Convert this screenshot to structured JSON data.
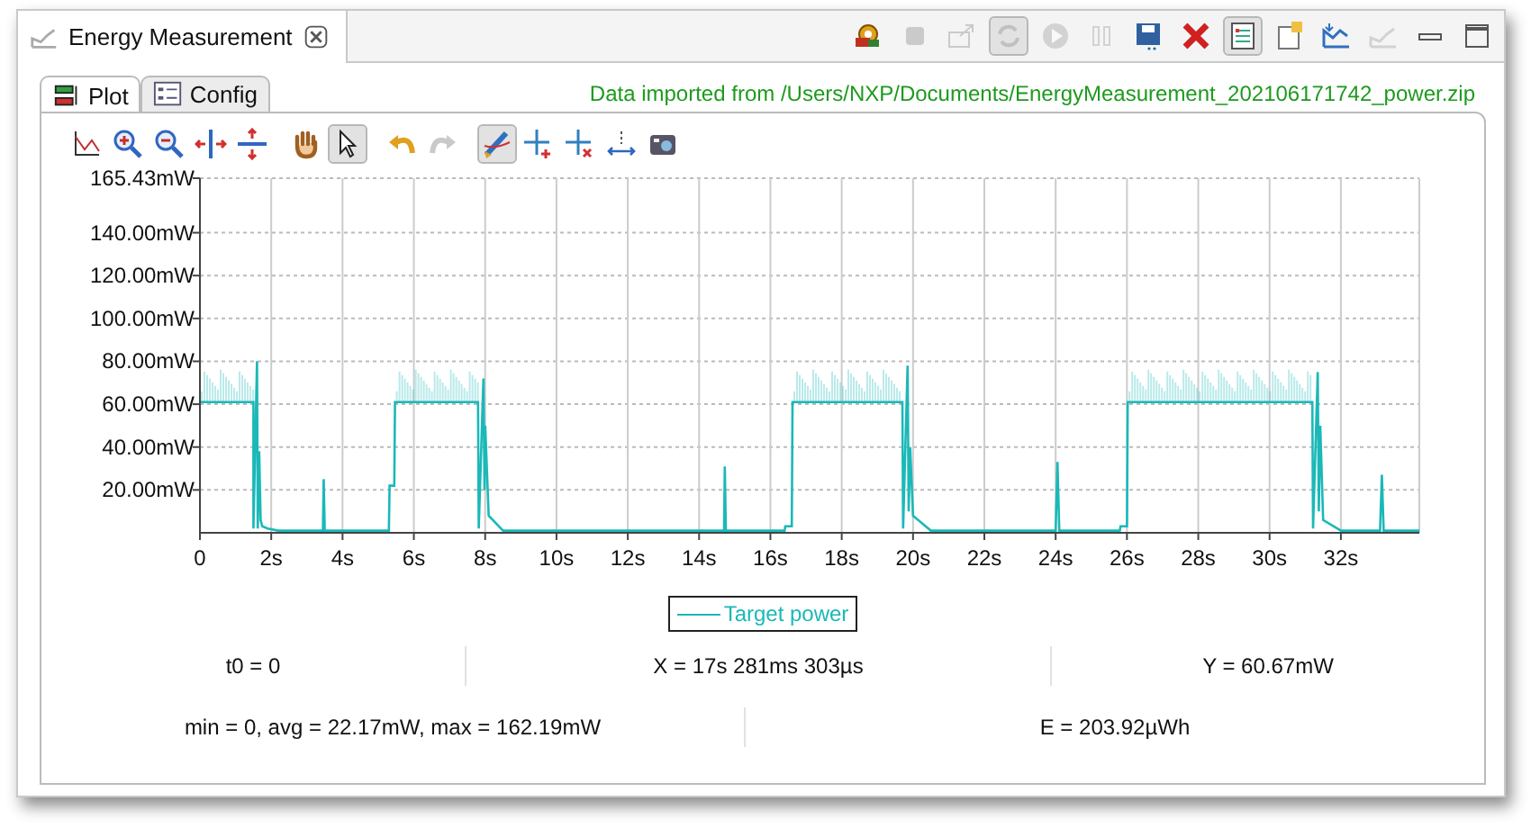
{
  "view_tab": {
    "title": "Energy Measurement",
    "selected": true
  },
  "view_toolbar": [
    {
      "kind": "gear-person",
      "disabled": false,
      "selected": false
    },
    {
      "kind": "stop",
      "disabled": true,
      "selected": false
    },
    {
      "kind": "export",
      "disabled": true,
      "selected": false
    },
    {
      "kind": "sync",
      "disabled": true,
      "selected": true
    },
    {
      "kind": "play",
      "disabled": true,
      "selected": false
    },
    {
      "kind": "pause",
      "disabled": true,
      "selected": false
    },
    {
      "kind": "save",
      "disabled": false,
      "selected": false
    },
    {
      "kind": "delete",
      "disabled": false,
      "selected": false
    },
    {
      "kind": "list",
      "disabled": false,
      "selected": true
    },
    {
      "kind": "note",
      "disabled": false,
      "selected": false
    },
    {
      "kind": "chart-in",
      "disabled": false,
      "selected": false
    },
    {
      "kind": "chart-out",
      "disabled": true,
      "selected": false
    },
    {
      "kind": "minimize",
      "disabled": false,
      "selected": false
    },
    {
      "kind": "maximize",
      "disabled": false,
      "selected": false
    }
  ],
  "tabs": [
    {
      "label": "Plot",
      "kind": "plot",
      "selected": true
    },
    {
      "label": "Config",
      "kind": "config",
      "selected": false
    }
  ],
  "import_message": "Data imported from /Users/NXP/Documents/EnergyMeasurement_202106171742_power.zip",
  "plot_toolbar": [
    {
      "kind": "axis-scale",
      "selected": false,
      "disabled": false
    },
    {
      "kind": "zoom-in",
      "selected": false,
      "disabled": false
    },
    {
      "kind": "zoom-out",
      "selected": false,
      "disabled": false
    },
    {
      "kind": "stretch-h",
      "selected": false,
      "disabled": false
    },
    {
      "kind": "stretch-v",
      "selected": false,
      "disabled": false
    },
    {
      "kind": "hand",
      "selected": false,
      "disabled": false
    },
    {
      "kind": "pointer",
      "selected": true,
      "disabled": false
    },
    {
      "kind": "undo",
      "selected": false,
      "disabled": false
    },
    {
      "kind": "redo",
      "selected": false,
      "disabled": true
    },
    {
      "kind": "brush",
      "selected": true,
      "disabled": false
    },
    {
      "kind": "add-point",
      "selected": false,
      "disabled": false
    },
    {
      "kind": "remove-point",
      "selected": false,
      "disabled": false
    },
    {
      "kind": "measure",
      "selected": false,
      "disabled": false
    },
    {
      "kind": "camera",
      "selected": false,
      "disabled": false
    }
  ],
  "chart_data": {
    "type": "line",
    "xlim": [
      0,
      34.2
    ],
    "ylim": [
      0,
      165.43
    ],
    "xticks": [
      {
        "value": 0,
        "label": "0"
      },
      {
        "value": 2,
        "label": "2s"
      },
      {
        "value": 4,
        "label": "4s"
      },
      {
        "value": 6,
        "label": "6s"
      },
      {
        "value": 8,
        "label": "8s"
      },
      {
        "value": 10,
        "label": "10s"
      },
      {
        "value": 12,
        "label": "12s"
      },
      {
        "value": 14,
        "label": "14s"
      },
      {
        "value": 16,
        "label": "16s"
      },
      {
        "value": 18,
        "label": "18s"
      },
      {
        "value": 20,
        "label": "20s"
      },
      {
        "value": 22,
        "label": "22s"
      },
      {
        "value": 24,
        "label": "24s"
      },
      {
        "value": 26,
        "label": "26s"
      },
      {
        "value": 28,
        "label": "28s"
      },
      {
        "value": 30,
        "label": "30s"
      },
      {
        "value": 32,
        "label": "32s"
      }
    ],
    "yticks": [
      {
        "value": 20,
        "label": "20.00mW"
      },
      {
        "value": 40,
        "label": "40.00mW"
      },
      {
        "value": 60,
        "label": "60.00mW"
      },
      {
        "value": 80,
        "label": "80.00mW"
      },
      {
        "value": 100,
        "label": "100.00mW"
      },
      {
        "value": 120,
        "label": "120.00mW"
      },
      {
        "value": 140,
        "label": "140.00mW"
      },
      {
        "value": 165.43,
        "label": "165.43mW"
      }
    ],
    "x": [
      0,
      1.5,
      1.5,
      1.6,
      1.62,
      1.66,
      1.7,
      1.75,
      1.9,
      2.2,
      3.45,
      3.47,
      3.5,
      5.3,
      5.32,
      5.45,
      5.47,
      7.8,
      7.82,
      7.95,
      7.98,
      8.0,
      8.1,
      8.5,
      14.7,
      14.72,
      14.75,
      16.4,
      16.42,
      16.6,
      16.62,
      19.7,
      19.72,
      19.85,
      19.88,
      19.92,
      20.0,
      20.5,
      24.0,
      24.05,
      24.1,
      25.8,
      25.82,
      26.0,
      26.02,
      31.2,
      31.22,
      31.35,
      31.38,
      31.42,
      31.5,
      32.0,
      33.1,
      33.15,
      33.2,
      34.2
    ],
    "grid": true,
    "series": [
      {
        "name": "Target power",
        "color": "#1bb8b8",
        "values": [
          61,
          61,
          2,
          80,
          2,
          38,
          6,
          3,
          2,
          1,
          1,
          25,
          1,
          1,
          22,
          22,
          61,
          61,
          2,
          72,
          20,
          50,
          8,
          1,
          1,
          31,
          1,
          1,
          3,
          3,
          61,
          61,
          2,
          78,
          10,
          40,
          8,
          1,
          1,
          33,
          1,
          1,
          3,
          3,
          61,
          61,
          2,
          75,
          10,
          50,
          6,
          1,
          1,
          27,
          1,
          1
        ]
      }
    ]
  },
  "stats": {
    "row_1": [
      "t0 = 0",
      "X = 17s 281ms 303µs",
      "Y = 60.67mW"
    ],
    "row_2": [
      "min = 0, avg = 22.17mW, max = 162.19mW",
      "E = 203.92µWh"
    ]
  }
}
